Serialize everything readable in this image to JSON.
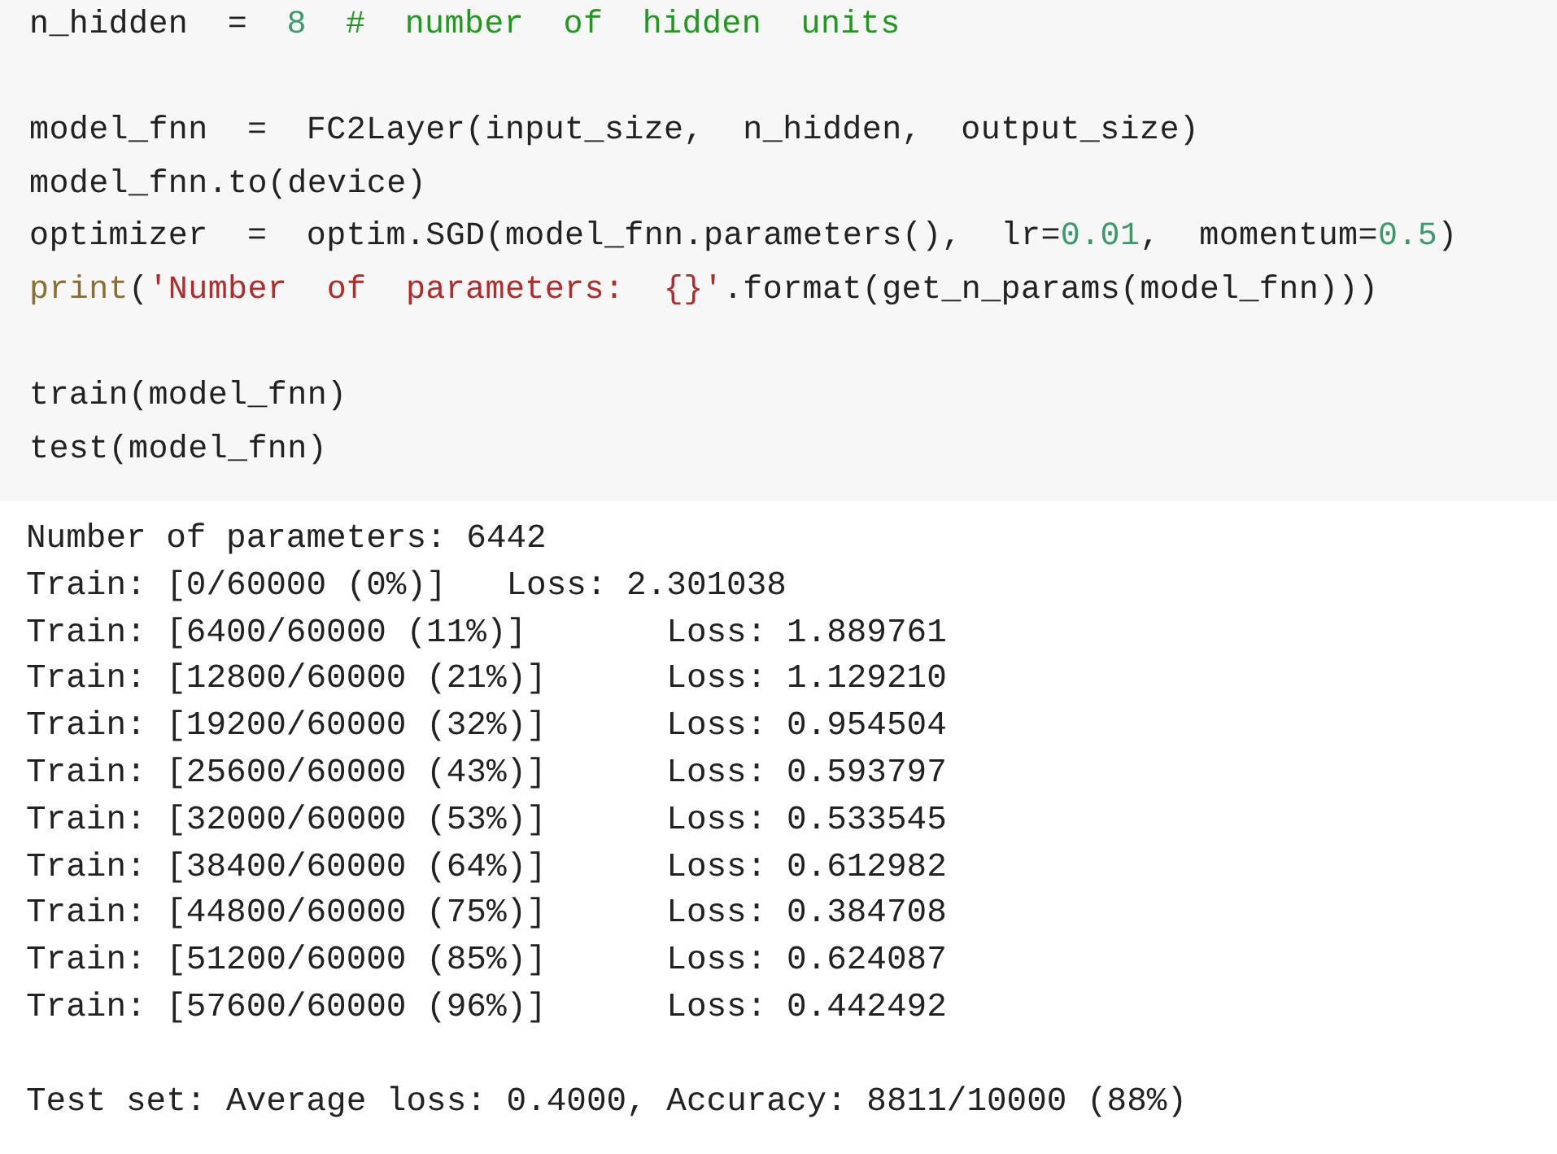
{
  "code_cell": {
    "lines": [
      {
        "kind": "code",
        "tokens": [
          {
            "text": "n_hidden = ",
            "kind": "name"
          },
          {
            "text": "8",
            "kind": "number"
          },
          {
            "text": "# number of hidden units",
            "kind": "comment"
          }
        ]
      },
      {
        "kind": "blank"
      },
      {
        "kind": "code",
        "tokens": [
          {
            "text": "model_fnn = FC2Layer(input_size, n_hidden, output_size)",
            "kind": "name"
          }
        ]
      },
      {
        "kind": "code",
        "tokens": [
          {
            "text": "model_fnn.to(device)",
            "kind": "name"
          }
        ]
      },
      {
        "kind": "code",
        "tokens": [
          {
            "text": "optimizer = optim.SGD(model_fnn.parameters(), lr=",
            "kind": "name"
          },
          {
            "text": "0.01",
            "kind": "number"
          },
          {
            "text": ", momentum=",
            "kind": "name"
          },
          {
            "text": "0.5",
            "kind": "number"
          },
          {
            "text": ")",
            "kind": "name"
          }
        ]
      },
      {
        "kind": "code",
        "tokens": [
          {
            "text": "print",
            "kind": "builtin"
          },
          {
            "text": "(",
            "kind": "name"
          },
          {
            "text": "'Number of parameters: {}'",
            "kind": "string"
          },
          {
            "text": ".format(get_n_params(model_fnn)))",
            "kind": "name"
          }
        ]
      },
      {
        "kind": "blank"
      },
      {
        "kind": "code",
        "tokens": [
          {
            "text": "train(model_fnn)",
            "kind": "name"
          }
        ]
      },
      {
        "kind": "code",
        "tokens": [
          {
            "text": "test(model_fnn)",
            "kind": "name"
          }
        ]
      }
    ]
  },
  "output": {
    "lines": [
      {
        "kind": "text",
        "text": "Number of parameters: 6442"
      },
      {
        "kind": "train",
        "progress": "Train: [0/60000 (0%)]",
        "loss": "Loss: 2.301038"
      },
      {
        "kind": "train",
        "progress": "Train: [6400/60000 (11%)]",
        "loss": "Loss: 1.889761"
      },
      {
        "kind": "train",
        "progress": "Train: [12800/60000 (21%)]",
        "loss": "Loss: 1.129210"
      },
      {
        "kind": "train",
        "progress": "Train: [19200/60000 (32%)]",
        "loss": "Loss: 0.954504"
      },
      {
        "kind": "train",
        "progress": "Train: [25600/60000 (43%)]",
        "loss": "Loss: 0.593797"
      },
      {
        "kind": "train",
        "progress": "Train: [32000/60000 (53%)]",
        "loss": "Loss: 0.533545"
      },
      {
        "kind": "train",
        "progress": "Train: [38400/60000 (64%)]",
        "loss": "Loss: 0.612982"
      },
      {
        "kind": "train",
        "progress": "Train: [44800/60000 (75%)]",
        "loss": "Loss: 0.384708"
      },
      {
        "kind": "train",
        "progress": "Train: [51200/60000 (85%)]",
        "loss": "Loss: 0.624087"
      },
      {
        "kind": "train",
        "progress": "Train: [57600/60000 (96%)]",
        "loss": "Loss: 0.442492"
      },
      {
        "kind": "blank"
      },
      {
        "kind": "text",
        "text": "Test set: Average loss: 0.4000, Accuracy: 8811/10000 (88%)"
      }
    ]
  }
}
